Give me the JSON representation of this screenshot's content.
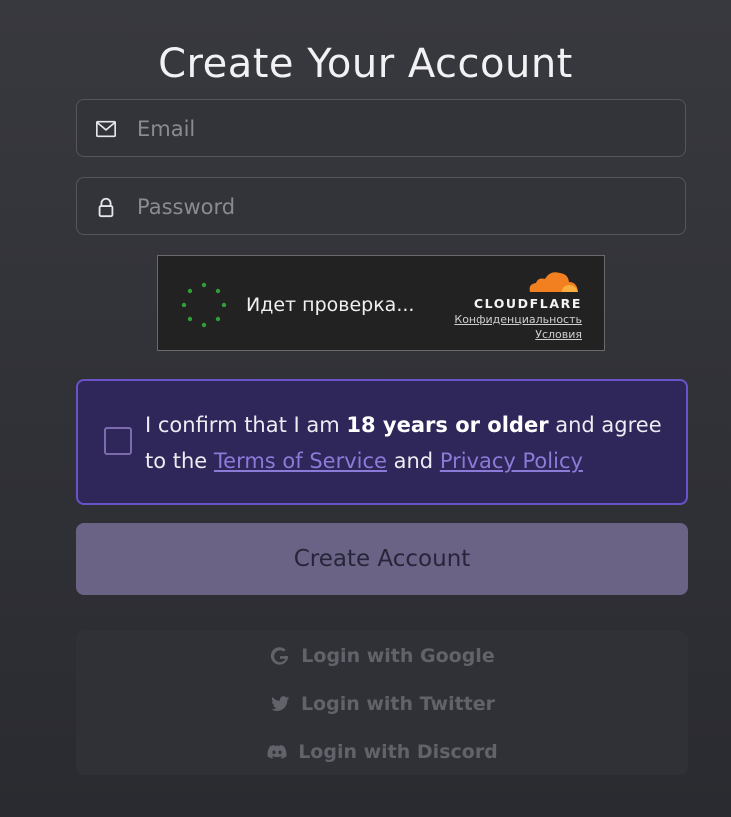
{
  "page": {
    "title": "Create Your Account"
  },
  "form": {
    "email_placeholder": "Email",
    "password_placeholder": "Password"
  },
  "captcha": {
    "status": "Идет проверка...",
    "brand": "CLOUDFLARE",
    "privacy_link": "Конфиденциальность",
    "terms_link": "Условия"
  },
  "consent": {
    "prefix": "I confirm that I am ",
    "age": "18 years or older",
    "middle": " and agree to the ",
    "tos": "Terms of Service",
    "and": " and ",
    "privacy": "Privacy Policy",
    "checked": false
  },
  "submit": {
    "label": "Create Account"
  },
  "social": [
    {
      "label": "Login with Google",
      "icon": "google-icon"
    },
    {
      "label": "Login with Twitter",
      "icon": "twitter-icon"
    },
    {
      "label": "Login with Discord",
      "icon": "discord-icon"
    }
  ],
  "colors": {
    "accent": "#6a52c7",
    "consent_bg": "#2f2659",
    "button_bg": "#6b6385",
    "link": "#8c7ad8",
    "cloudflare_orange": "#f38020"
  }
}
